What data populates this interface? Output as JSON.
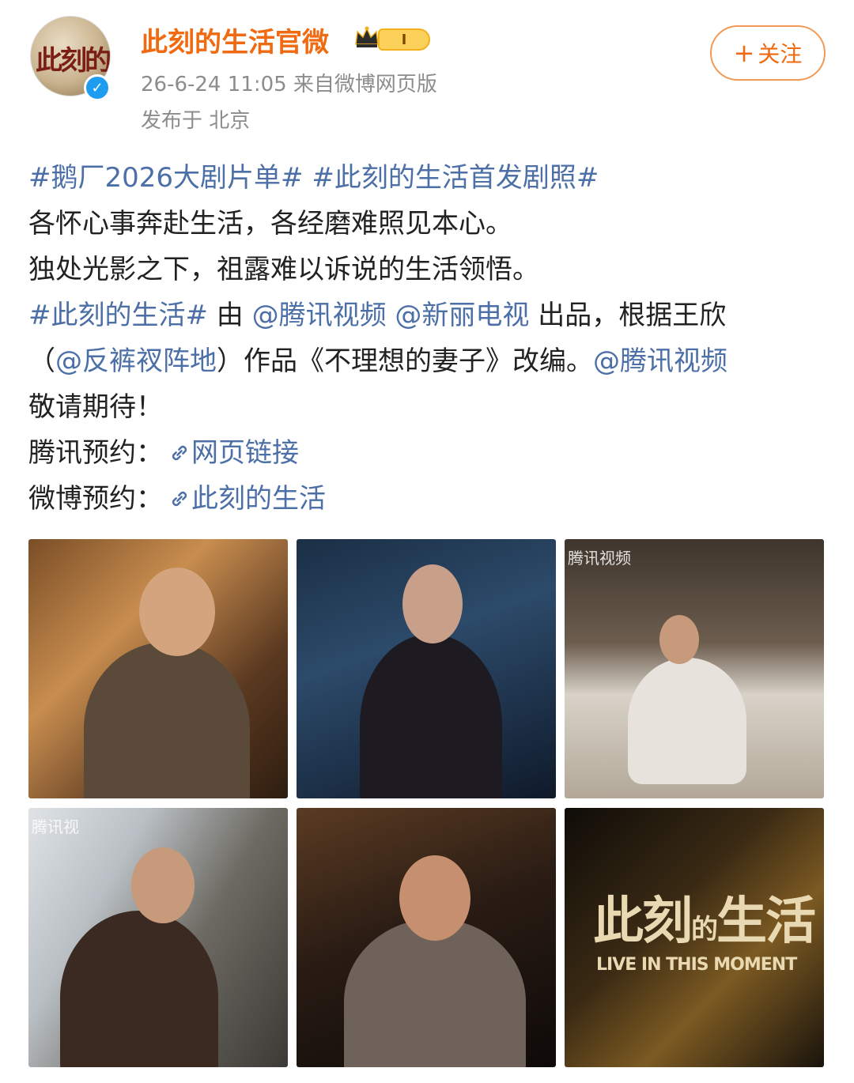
{
  "user": {
    "name": "此刻的生活官微",
    "avatar_text": "此刻的生活",
    "vip_level": "I",
    "verify_symbol": "✓",
    "time_source": "26-6-24 11:05  来自微博网页版",
    "location": "发布于 北京"
  },
  "follow_button": {
    "plus": "+",
    "label": "关注"
  },
  "post": {
    "hashtag1": "#鹅厂2026大剧片单#",
    "hashtag2": "#此刻的生活首发剧照#",
    "line2": "各怀心事奔赴生活，各经磨难照见本心。",
    "line3": "独处光影之下，祖露难以诉说的生活领悟。",
    "hashtag3": "#此刻的生活#",
    "text_you": " 由 ",
    "mention1": "@腾讯视频",
    "mention2": "@新丽电视",
    "text_chupin": " 出品，根据王欣",
    "paren_open": "（",
    "mention3": "@反裤衩阵地",
    "text_zuopin": "）作品《不理想的妻子》改编。",
    "mention4": "@腾讯视频",
    "line6": "敬请期待！",
    "link1_label": "腾讯预约：",
    "link1_text": "网页链接",
    "link2_label": "微博预约：",
    "link2_text": "此刻的生活"
  },
  "photos": {
    "watermark": "腾讯视频",
    "watermark_short": "腾讯视",
    "poster_title_a": "此刻",
    "poster_title_b": "的",
    "poster_title_c": "生活",
    "poster_subtitle": "LIVE IN THIS MOMENT"
  }
}
